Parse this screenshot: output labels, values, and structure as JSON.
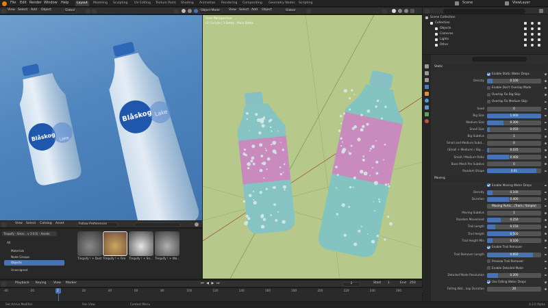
{
  "topbar": {
    "menus": [
      "File",
      "Edit",
      "Render",
      "Window",
      "Help"
    ],
    "workspaces": [
      "Layout",
      "Modeling",
      "Sculpting",
      "UV Editing",
      "Texture Paint",
      "Shading",
      "Animation",
      "Rendering",
      "Compositing",
      "Geometry Nodes",
      "Scripting"
    ],
    "active_workspace": "Layout",
    "scene": "Scene",
    "view_layer": "ViewLayer"
  },
  "left_viewport": {
    "view_menus": [
      "View",
      "Select",
      "Add",
      "Object"
    ],
    "transform": "Global",
    "labels": {
      "brand": "Blåskog",
      "sub": "Lake"
    }
  },
  "right_viewport": {
    "mode": "Object Mode",
    "menus": [
      "View",
      "Select",
      "Add",
      "Object"
    ],
    "transform": "Global",
    "title": "User Perspective",
    "subtitle": "(2) Scripts | 3 Bottle - Main Bottle"
  },
  "asset_browser": {
    "menus": [
      "View",
      "Select",
      "Catalog",
      "Asset"
    ],
    "filter": "Follow Preferences",
    "library": "Tinquify - Smar... v 3.0.0) - Assets",
    "catalog_all": "All",
    "catalogs": [
      "Materials",
      "Node Groups",
      "Objects",
      "Unassigned"
    ],
    "selected_catalog": "Objects",
    "assets": [
      "Tinquify ! + Dust",
      "Tinquify ! + Fire",
      "Tinquify ! + Sn...",
      "Tinquify ! + Wa..."
    ]
  },
  "timeline": {
    "menus": [
      "Playback",
      "Keying",
      "View",
      "Marker"
    ],
    "current_frame": "2",
    "start_label": "Start",
    "start": "1",
    "end_label": "End",
    "end": "250",
    "ticks": [
      "-40",
      "-20",
      "0",
      "20",
      "40",
      "60",
      "80",
      "100",
      "120",
      "140",
      "160",
      "180",
      "200",
      "220",
      "240",
      "260",
      "280"
    ],
    "playhead": "2"
  },
  "statusbar": {
    "items": [
      "Set Active Modifier",
      "Pan View",
      "Context Menu"
    ],
    "version": "4.2.0 Alpha"
  },
  "outliner": {
    "items": [
      {
        "label": "Scene Collection",
        "indent": 0
      },
      {
        "label": "Collection",
        "indent": 1
      },
      {
        "label": "Objects",
        "indent": 2
      },
      {
        "label": "Cameras",
        "indent": 2
      },
      {
        "label": "Lights",
        "indent": 2
      },
      {
        "label": "Other",
        "indent": 2
      }
    ]
  },
  "properties": {
    "static_section": "Static",
    "moving_section": "Moving",
    "rows": [
      {
        "type": "check",
        "label": "Enable Static Water Drops",
        "checked": true
      },
      {
        "type": "field",
        "label": "Density",
        "value": "0.100",
        "fill": 0.1
      },
      {
        "type": "check",
        "label": "Enable Don't Overlap Mode",
        "checked": false
      },
      {
        "type": "check",
        "label": "Overlap Fix Big Skip",
        "checked": false
      },
      {
        "type": "check",
        "label": "Overlap Fix Medium Skip",
        "checked": false
      },
      {
        "type": "field",
        "label": "Seed",
        "value": "0",
        "fill": 0
      },
      {
        "type": "field",
        "label": "Big Size",
        "value": "1.000",
        "fill": 1.0
      },
      {
        "type": "field",
        "label": "Medium Size",
        "value": "0.300",
        "fill": 0.3
      },
      {
        "type": "field",
        "label": "Small Size",
        "value": "0.050",
        "fill": 0.05
      },
      {
        "type": "field",
        "label": "Big Subdivs",
        "value": "1",
        "fill": 0
      },
      {
        "type": "field",
        "label": "Small and Medium Subd...",
        "value": "0",
        "fill": 0
      },
      {
        "type": "field",
        "label": "(Small + Medium) / Big ...",
        "value": "0.035",
        "fill": 0.035
      },
      {
        "type": "field",
        "label": "Small / Medium Ratio",
        "value": "0.400",
        "fill": 0.4
      },
      {
        "type": "field",
        "label": "Base Mesh Pre Subdivs",
        "value": "0",
        "fill": 0
      },
      {
        "type": "field",
        "label": "Random Shape",
        "value": "0.91­",
        "fill": 0.91
      }
    ],
    "moving_rows": [
      {
        "type": "check",
        "label": "Enable Moving Water Drops",
        "checked": true
      },
      {
        "type": "field",
        "label": "Density",
        "value": "0.100",
        "fill": 0.1
      },
      {
        "type": "field",
        "label": "Duration",
        "value": "0.400",
        "fill": 0.4
      },
      {
        "type": "field",
        "label": "",
        "value": "Moving Partic...(Trails / Simple)",
        "fill": 0
      },
      {
        "type": "field",
        "label": "Moving Subdivs",
        "value": "1",
        "fill": 0
      },
      {
        "type": "field",
        "label": "Random Movement",
        "value": "0.250",
        "fill": 0.25
      },
      {
        "type": "field",
        "label": "Trail Length",
        "value": "0.150",
        "fill": 0.15
      },
      {
        "type": "field",
        "label": "Trail Height",
        "value": "0.500",
        "fill": 0.5
      },
      {
        "type": "field",
        "label": "Trail Height Min",
        "value": "0.100",
        "fill": 0.1
      },
      {
        "type": "check",
        "label": "Enable Trail Remover",
        "checked": true
      },
      {
        "type": "field",
        "label": "Trail Remover Length",
        "value": "0.850",
        "fill": 0.85
      },
      {
        "type": "check",
        "label": "Preview Trail Remover",
        "checked": false
      },
      {
        "type": "check",
        "label": "Enable Detailed Mode",
        "checked": false
      },
      {
        "type": "field",
        "label": "Detailed Mode Resolution",
        "value": "0.200",
        "fill": 0.2
      },
      {
        "type": "check",
        "label": "Use Falling Water Drops",
        "checked": true
      },
      {
        "type": "field",
        "label": "Falling Wat...nap Duration",
        "value": "20",
        "fill": 0
      }
    ]
  }
}
